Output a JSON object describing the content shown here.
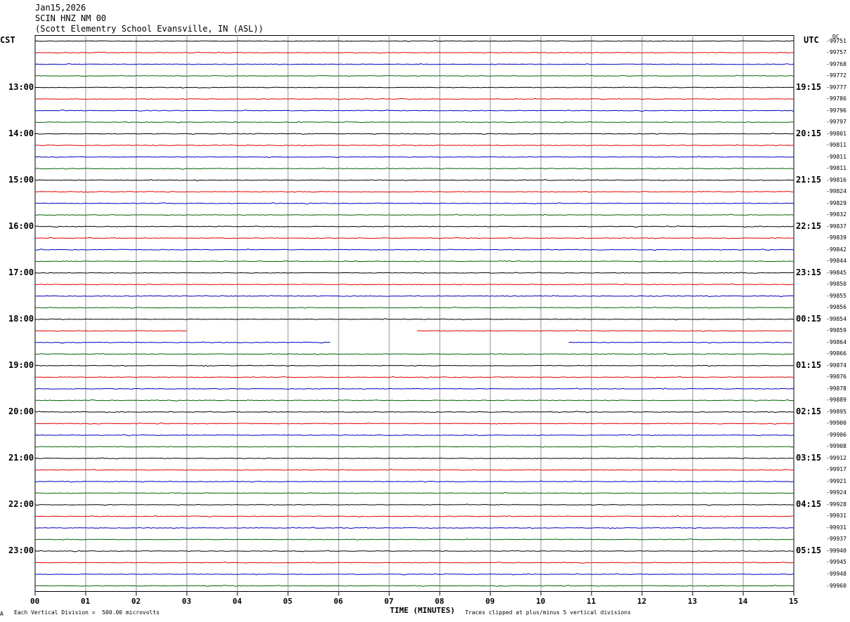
{
  "header": {
    "date": "Jan15,2026",
    "station": "SCIN HNZ NM 00",
    "location": "(Scott Elementry School Evansville, IN (ASL))"
  },
  "left_zone": "CST",
  "right_zone": "UTC",
  "dc_label": "DC",
  "footer": {
    "scale_note": "Each Vertical Division =  500.00 microvolts",
    "clip_note": "Traces clipped at plus/minus 5 vertical divisions",
    "corner_mark": "A"
  },
  "colors": {
    "black": "#000000",
    "red": "#e00000",
    "blue": "#0000c0",
    "green": "#006400",
    "grid": "#9090a0"
  },
  "chart_data": {
    "type": "helicorder",
    "xlabel": "TIME (MINUTES)",
    "x_ticks": [
      "00",
      "01",
      "02",
      "03",
      "04",
      "05",
      "06",
      "07",
      "08",
      "09",
      "10",
      "11",
      "12",
      "13",
      "14",
      "15"
    ],
    "xlim": [
      0,
      15
    ],
    "minutes_per_line": 15,
    "left_time_labels": [
      "13:00",
      "14:00",
      "15:00",
      "16:00",
      "17:00",
      "18:00",
      "19:00",
      "20:00",
      "21:00",
      "22:00",
      "23:00"
    ],
    "right_time_labels": [
      "19:15",
      "20:15",
      "21:15",
      "22:15",
      "23:15",
      "00:15",
      "01:15",
      "02:15",
      "03:15",
      "04:15",
      "05:15"
    ],
    "trace_color_cycle": [
      "black",
      "red",
      "blue",
      "green"
    ],
    "dc_offsets": [
      "-99751",
      "-99757",
      "-99768",
      "-99772",
      "-99777",
      "-99786",
      "-99796",
      "-99797",
      "-99801",
      "-99811",
      "-99811",
      "-99811",
      "-99816",
      "-99824",
      "-99829",
      "-99832",
      "-99837",
      "-99839",
      "-99842",
      "-99844",
      "-99845",
      "-99850",
      "-99855",
      "-99856",
      "-99854",
      "-99859",
      "-99864",
      "-99866",
      "-99874",
      "-99876",
      "-99878",
      "-99889",
      "-99895",
      "-99900",
      "-99906",
      "-99908",
      "-99912",
      "-99917",
      "-99921",
      "-99924",
      "-99928",
      "-99931",
      "-99931",
      "-99937",
      "-99940",
      "-99945",
      "-99948",
      "-99960"
    ],
    "data_gaps": [
      {
        "trace": 25,
        "from_minute": 3.0,
        "to_minute": 7.55
      },
      {
        "trace": 26,
        "from_minute": 5.85,
        "to_minute": 10.55
      }
    ]
  }
}
